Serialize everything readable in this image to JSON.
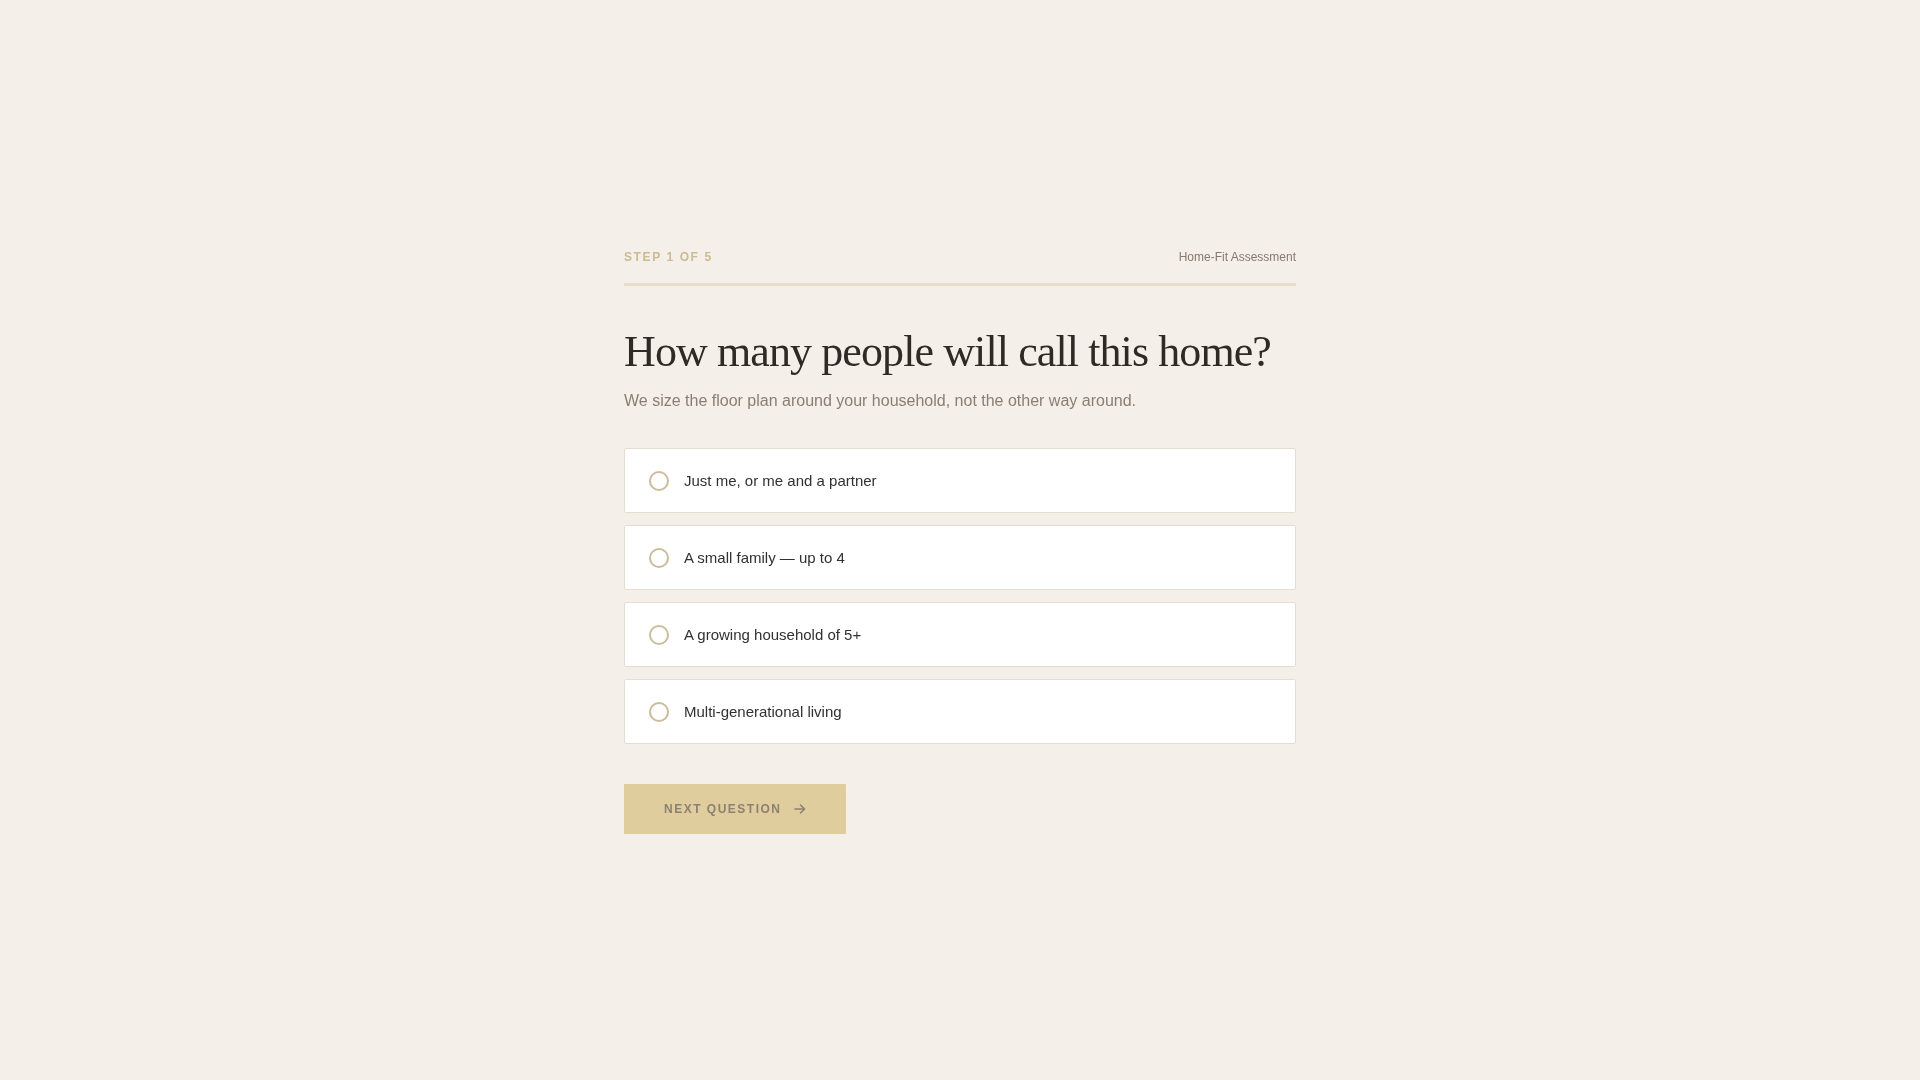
{
  "header": {
    "step": "STEP 1 OF 5",
    "title": "Home-Fit Assessment"
  },
  "question": {
    "title": "How many people will call this home?",
    "subtitle": "We size the floor plan around your household, not the other way around."
  },
  "options": [
    {
      "label": "Just me, or me and a partner",
      "selected": false
    },
    {
      "label": "A small family — up to 4",
      "selected": false
    },
    {
      "label": "A growing household of 5+",
      "selected": false
    },
    {
      "label": "Multi-generational living",
      "selected": false
    }
  ],
  "next_button": {
    "label": "NEXT QUESTION",
    "disabled": true
  }
}
